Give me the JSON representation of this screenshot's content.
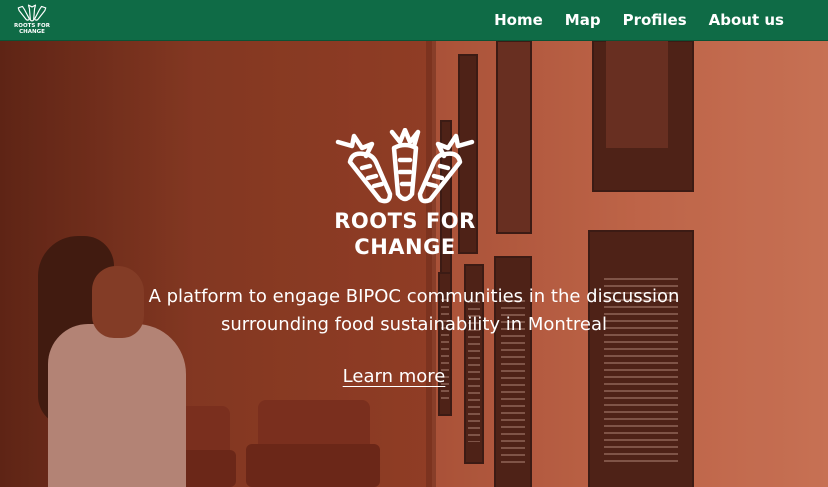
{
  "brand": {
    "name": "ROOTS FOR\nCHANGE",
    "icon": "carrots-logo-icon"
  },
  "nav": {
    "items": [
      {
        "label": "Home"
      },
      {
        "label": "Map"
      },
      {
        "label": "Profiles"
      },
      {
        "label": "About us"
      }
    ]
  },
  "hero": {
    "logo_text": "ROOTS FOR\nCHANGE",
    "tagline": "A platform to engage BIPOC communities in the discussion surrounding food sustainability in Montreal",
    "cta_label": "Learn more",
    "background": "woman-viewing-art-gallery-photo"
  },
  "colors": {
    "nav_bg": "#0f6b46",
    "text": "#ffffff"
  }
}
